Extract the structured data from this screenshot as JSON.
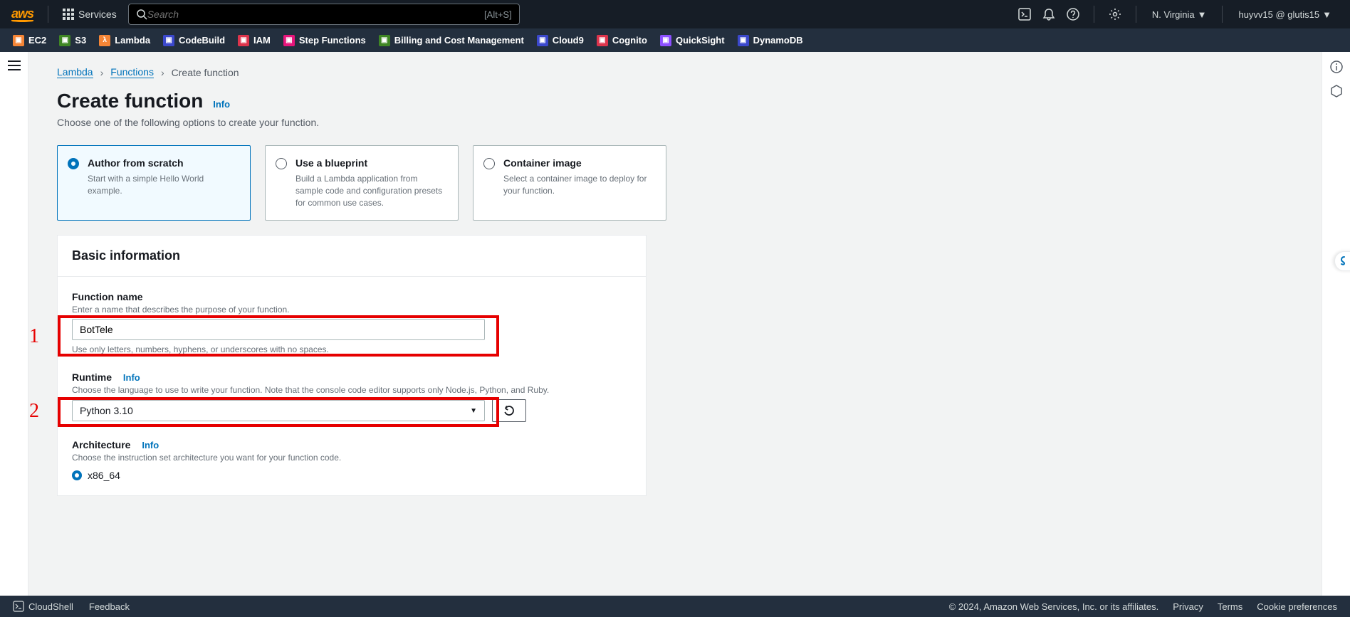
{
  "nav": {
    "services_label": "Services",
    "search_placeholder": "Search",
    "search_shortcut": "[Alt+S]",
    "region": "N. Virginia",
    "account": "huyvv15 @ glutis15"
  },
  "favorites": [
    {
      "label": "EC2",
      "color": "#f58536"
    },
    {
      "label": "S3",
      "color": "#3f8624"
    },
    {
      "label": "Lambda",
      "color": "#f58536"
    },
    {
      "label": "CodeBuild",
      "color": "#3b48cc"
    },
    {
      "label": "IAM",
      "color": "#dd344c"
    },
    {
      "label": "Step Functions",
      "color": "#e7157b"
    },
    {
      "label": "Billing and Cost Management",
      "color": "#3f8624"
    },
    {
      "label": "Cloud9",
      "color": "#3b48cc"
    },
    {
      "label": "Cognito",
      "color": "#dd344c"
    },
    {
      "label": "QuickSight",
      "color": "#8c4fff"
    },
    {
      "label": "DynamoDB",
      "color": "#3b48cc"
    }
  ],
  "breadcrumb": {
    "root": "Lambda",
    "mid": "Functions",
    "current": "Create function"
  },
  "page": {
    "title": "Create function",
    "info": "Info",
    "subtitle": "Choose one of the following options to create your function."
  },
  "options": [
    {
      "title": "Author from scratch",
      "desc": "Start with a simple Hello World example."
    },
    {
      "title": "Use a blueprint",
      "desc": "Build a Lambda application from sample code and configuration presets for common use cases."
    },
    {
      "title": "Container image",
      "desc": "Select a container image to deploy for your function."
    }
  ],
  "panel": {
    "title": "Basic information",
    "fn_label": "Function name",
    "fn_hint": "Enter a name that describes the purpose of your function.",
    "fn_value": "BotTele",
    "fn_constraint": "Use only letters, numbers, hyphens, or underscores with no spaces.",
    "rt_label": "Runtime",
    "rt_info": "Info",
    "rt_hint": "Choose the language to use to write your function. Note that the console code editor supports only Node.js, Python, and Ruby.",
    "rt_value": "Python 3.10",
    "arch_label": "Architecture",
    "arch_info": "Info",
    "arch_hint": "Choose the instruction set architecture you want for your function code.",
    "arch_value": "x86_64"
  },
  "annotations": {
    "one": "1",
    "two": "2"
  },
  "footer": {
    "cloudshell": "CloudShell",
    "feedback": "Feedback",
    "copyright": "© 2024, Amazon Web Services, Inc. or its affiliates.",
    "privacy": "Privacy",
    "terms": "Terms",
    "cookies": "Cookie preferences"
  }
}
